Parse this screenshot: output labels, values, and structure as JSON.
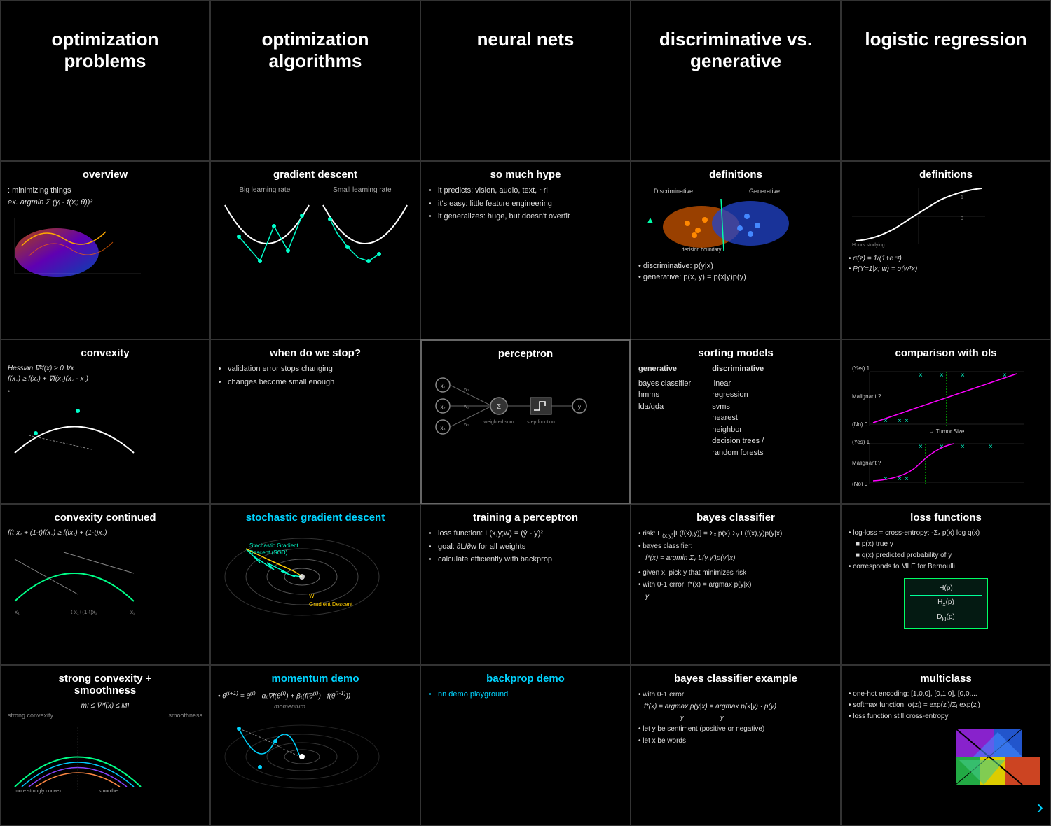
{
  "cells": [
    {
      "id": "r1c1",
      "row": 1,
      "title": "optimization\nproblems",
      "titleLarge": true,
      "content": ""
    },
    {
      "id": "r1c2",
      "row": 1,
      "title": "optimization\nalgorithms",
      "titleLarge": true,
      "content": ""
    },
    {
      "id": "r1c3",
      "row": 1,
      "title": "neural nets",
      "titleLarge": true,
      "content": ""
    },
    {
      "id": "r1c4",
      "row": 1,
      "title": "discriminative vs.\ngenerative",
      "titleLarge": true,
      "content": ""
    },
    {
      "id": "r1c5",
      "row": 1,
      "title": "logistic regression",
      "titleLarge": true,
      "content": ""
    },
    {
      "id": "r2c1",
      "row": 2,
      "title": "overview",
      "content": "minimizing things\nex. argmin Σ(yᵢ - f(xᵢ; θ))²"
    },
    {
      "id": "r2c2",
      "row": 2,
      "title": "gradient descent",
      "content": "Big learning rate   Small learning rate"
    },
    {
      "id": "r2c3",
      "row": 2,
      "title": "so much hype",
      "bullets": [
        "it predicts: vision, audio, text, ~rl",
        "it's easy: little feature engineering",
        "it generalizes: huge, but doesn't overfit"
      ]
    },
    {
      "id": "r2c4",
      "row": 2,
      "title": "definitions",
      "bullets": [
        "discriminative: p(y|x)",
        "generative: p(x, y) = p(x|y)p(y)"
      ]
    },
    {
      "id": "r2c5",
      "row": 2,
      "title": "definitions",
      "bullets": [
        "σ(z) = 1/(1+e⁻ᶻ)",
        "P(Y=1|x; w) = σ(wᵀx)"
      ]
    },
    {
      "id": "r3c1",
      "row": 3,
      "title": "convexity",
      "content": "Hessian ∇²f(x) ≥ 0 ∀x\nf(x₂) ≥ f(x₁) + ∇f(x₁)(x₂ - x₁)"
    },
    {
      "id": "r3c2",
      "row": 3,
      "title": "when do we stop?",
      "bullets": [
        "validation error stops changing",
        "changes become small enough"
      ]
    },
    {
      "id": "r3c3",
      "row": 3,
      "title": "perceptron",
      "highlighted": true
    },
    {
      "id": "r3c4",
      "row": 3,
      "title": "sorting models",
      "generative": [
        "bayes classifier",
        "hmms",
        "lda/qda"
      ],
      "discriminative": [
        "linear",
        "regression",
        "svms",
        "nearest",
        "neighbor",
        "decision trees /",
        "random forests"
      ]
    },
    {
      "id": "r3c5",
      "row": 3,
      "title": "comparison with ols"
    },
    {
      "id": "r4c1",
      "row": 4,
      "title": "convexity continued",
      "content": "f(t·x₁ + (1-t)x₂) ≥ f(tx₁) + (1-t)x₂)"
    },
    {
      "id": "r4c2",
      "row": 4,
      "title": "stochastic gradient descent",
      "titleCyan": true
    },
    {
      "id": "r4c3",
      "row": 4,
      "title": "training a perceptron",
      "bullets": [
        "loss function: L(x,y;w) = (ŷ - y)²",
        "goal: ∂L/∂w for all weights",
        "calculate efficiently with backprop"
      ]
    },
    {
      "id": "r4c4",
      "row": 4,
      "title": "bayes classifier",
      "bullets": [
        "risk: E[L(f(x),y)] = Σₓ p(x) Σᵧ L(f(x),y)p(y|x)",
        "bayes classifier: f*(x) = argmin Σᵧ L(y,y')p(y'|x)",
        "given x, pick y that minimizes risk",
        "with 0-1 error: f*(x) = argmax p(y|x)"
      ]
    },
    {
      "id": "r4c5",
      "row": 4,
      "title": "loss functions",
      "bullets": [
        "log-loss = cross-entropy: -Σₓ p(x) log q(x)",
        "p(x) true y",
        "q(x) predicted probability of y",
        "corresponds to MLE for Bernoulli"
      ],
      "lossBox": [
        "H(p)",
        "Hₓ(p)",
        "Dₖₗ(p)"
      ]
    },
    {
      "id": "r5c1",
      "row": 5,
      "title": "strong convexity +\nsmoothness",
      "content": "mI ≤ ∇²f(x) ≤ MI\nstrong convexity    smoothness"
    },
    {
      "id": "r5c2",
      "row": 5,
      "title": "momentum demo",
      "titleCyan": true,
      "content": "θ^(t+1) = θ^(t) - αₜ∇f(θ^(t)) + βₜ(f(θ^(t)) - f(θ^(t-1)))\nmomentum"
    },
    {
      "id": "r5c3",
      "row": 5,
      "title": "backprop demo",
      "titleCyan": true,
      "bullets": [
        "nn demo playground"
      ]
    },
    {
      "id": "r5c4",
      "row": 5,
      "title": "bayes classifier example",
      "bullets": [
        "with 0-1 error: f*(x) = argmax p(y|x) = argmax p(x|y) · p(y)",
        "let y be sentiment (positive or negative)",
        "let x be words"
      ]
    },
    {
      "id": "r5c5",
      "row": 5,
      "title": "multiclass",
      "bullets": [
        "one-hot encoding: [1,0,0], [0,1,0], [0,0,...",
        "softmax function: σ(zᵢ) = exp(zᵢ)/Σⱼ exp(zⱼ)",
        "loss function still cross-entropy"
      ]
    }
  ],
  "nav": {
    "arrow": "›"
  }
}
